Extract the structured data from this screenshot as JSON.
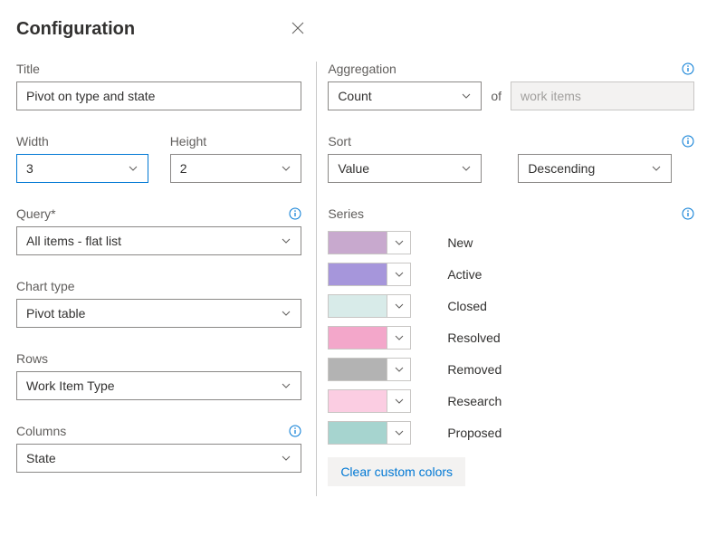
{
  "header": {
    "title": "Configuration"
  },
  "left": {
    "title_label": "Title",
    "title_value": "Pivot on type and state",
    "width_label": "Width",
    "width_value": "3",
    "height_label": "Height",
    "height_value": "2",
    "query_label": "Query*",
    "query_value": "All items - flat list",
    "chart_type_label": "Chart type",
    "chart_type_value": "Pivot table",
    "rows_label": "Rows",
    "rows_value": "Work Item Type",
    "columns_label": "Columns",
    "columns_value": "State"
  },
  "right": {
    "aggregation_label": "Aggregation",
    "aggregation_value": "Count",
    "of_label": "of",
    "of_value": "work items",
    "sort_label": "Sort",
    "sort_by_value": "Value",
    "sort_dir_value": "Descending",
    "series_label": "Series",
    "series": [
      {
        "label": "New",
        "color": "#c8a9ce"
      },
      {
        "label": "Active",
        "color": "#a696db"
      },
      {
        "label": "Closed",
        "color": "#d8ebe9"
      },
      {
        "label": "Resolved",
        "color": "#f3a7ca"
      },
      {
        "label": "Removed",
        "color": "#b3b3b3"
      },
      {
        "label": "Research",
        "color": "#fbcde2"
      },
      {
        "label": "Proposed",
        "color": "#a6d4cf"
      }
    ],
    "clear_colors_label": "Clear custom colors"
  }
}
